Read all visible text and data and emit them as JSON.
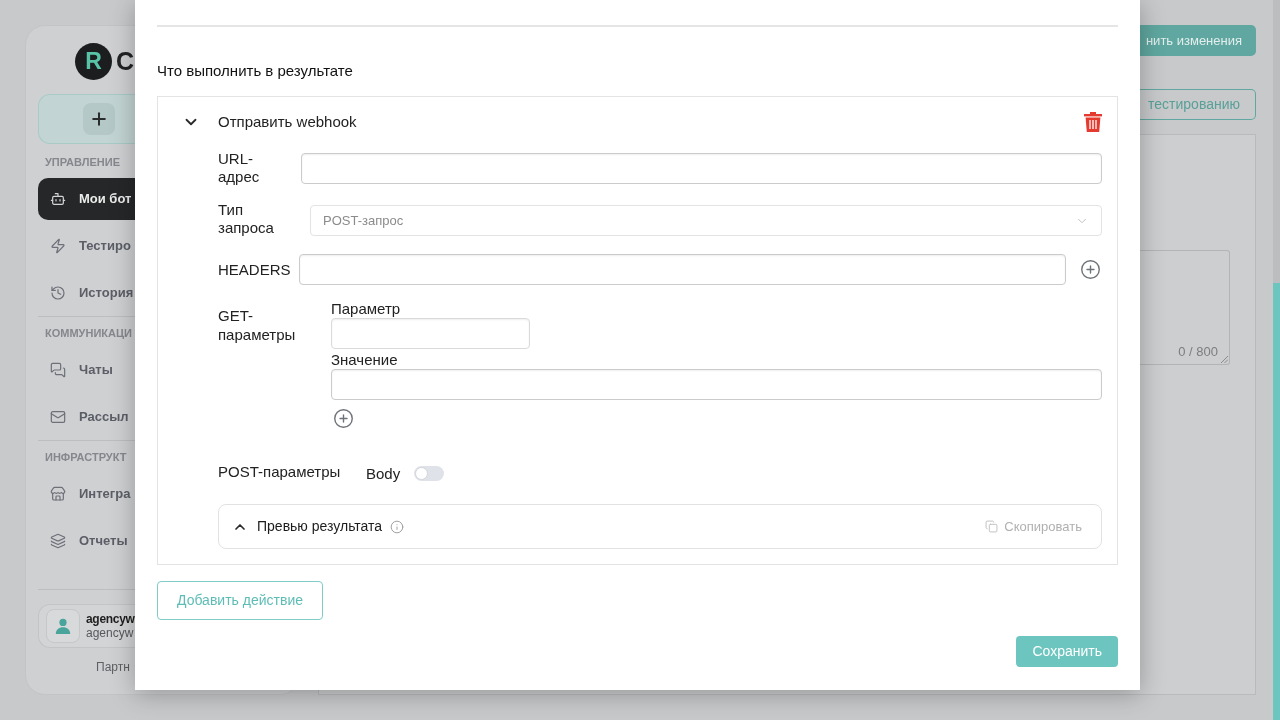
{
  "sidebar": {
    "logo": {
      "mark": "R",
      "text": "C"
    },
    "sections": [
      {
        "title": "УПРАВЛЕНИЕ",
        "items": [
          {
            "label": "Мои бот",
            "selected": true
          },
          {
            "label": "Тестиро",
            "selected": false
          },
          {
            "label": "История",
            "selected": false
          }
        ]
      },
      {
        "title": "КОММУНИКАЦИ",
        "items": [
          {
            "label": "Чаты",
            "selected": false
          },
          {
            "label": "Рассыл",
            "selected": false
          }
        ]
      },
      {
        "title": "ИНФРАСТРУКТ",
        "items": [
          {
            "label": "Интегра",
            "selected": false
          },
          {
            "label": "Отчеты",
            "selected": false
          }
        ]
      }
    ],
    "user": {
      "name": "agencyw",
      "email": "agencyw"
    },
    "footer": "Партн"
  },
  "page": {
    "buttons": [
      "нить изменения",
      "тестированию"
    ],
    "editor": {
      "counter": "0 / 800"
    }
  },
  "modal": {
    "title": "Что выполнить в результате",
    "actions": [
      {
        "title": "Отправить webhook",
        "expanded": true,
        "fields": [
          {
            "kind": "text",
            "label": "URL-адрес"
          },
          {
            "kind": "select",
            "label": "Тип запроса",
            "value": "POST-запрос",
            "disabled": true
          },
          {
            "kind": "list",
            "label": "HEADERS"
          },
          {
            "kind": "pairs",
            "label": "GET-параметры",
            "key_label": "Параметр",
            "value_label": "Значение"
          },
          {
            "kind": "switch",
            "label": "POST-параметры",
            "switch_label": "Body",
            "on": false
          }
        ],
        "preview": {
          "title": "Превью результата",
          "expanded": false,
          "copy_label": "Скопировать"
        }
      }
    ],
    "add_button": "Добавить действие",
    "save_button": "Сохранить"
  }
}
